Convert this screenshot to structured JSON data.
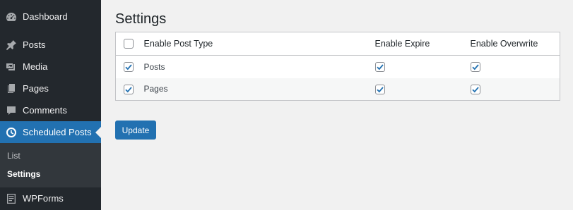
{
  "sidebar": {
    "items": [
      {
        "label": "Dashboard",
        "icon": "dashboard-icon"
      },
      {
        "label": "Posts",
        "icon": "pin-icon"
      },
      {
        "label": "Media",
        "icon": "media-icon"
      },
      {
        "label": "Pages",
        "icon": "pages-icon"
      },
      {
        "label": "Comments",
        "icon": "comment-icon"
      },
      {
        "label": "Scheduled Posts",
        "icon": "clock-icon",
        "active": true
      },
      {
        "label": "WPForms",
        "icon": "forms-icon"
      }
    ],
    "submenu": [
      {
        "label": "List"
      },
      {
        "label": "Settings",
        "current": true
      }
    ],
    "accent_color": "#2271b1"
  },
  "main": {
    "title": "Settings",
    "table": {
      "headers": {
        "type": "Enable Post Type",
        "expire": "Enable Expire",
        "overwrite": "Enable Overwrite"
      },
      "header_checked": false,
      "rows": [
        {
          "label": "Posts",
          "type_checked": true,
          "expire_checked": true,
          "overwrite_checked": true
        },
        {
          "label": "Pages",
          "type_checked": true,
          "expire_checked": true,
          "overwrite_checked": true
        }
      ]
    },
    "update_label": "Update"
  }
}
